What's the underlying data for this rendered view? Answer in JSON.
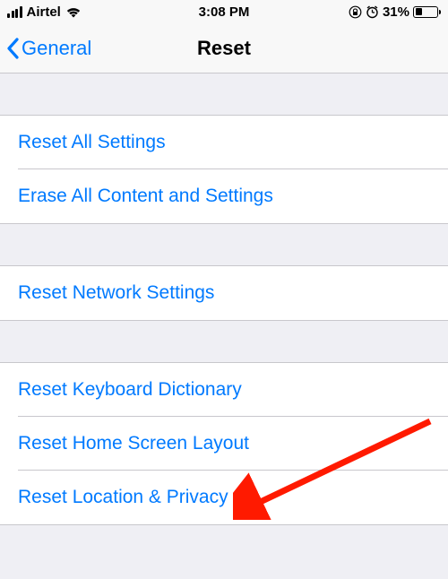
{
  "status": {
    "carrier": "Airtel",
    "time": "3:08 PM",
    "battery_percent": "31%",
    "battery_level": 31
  },
  "nav": {
    "back_label": "General",
    "title": "Reset"
  },
  "sections": [
    {
      "rows": [
        {
          "label": "Reset All Settings"
        },
        {
          "label": "Erase All Content and Settings"
        }
      ]
    },
    {
      "rows": [
        {
          "label": "Reset Network Settings"
        }
      ]
    },
    {
      "rows": [
        {
          "label": "Reset Keyboard Dictionary"
        },
        {
          "label": "Reset Home Screen Layout"
        },
        {
          "label": "Reset Location & Privacy"
        }
      ]
    }
  ]
}
